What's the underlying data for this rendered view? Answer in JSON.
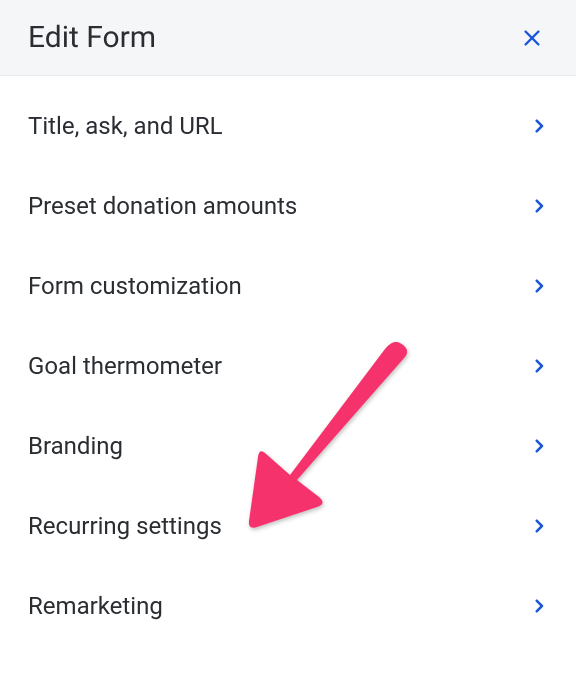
{
  "header": {
    "title": "Edit Form"
  },
  "menu": {
    "items": [
      {
        "label": "Title, ask, and URL"
      },
      {
        "label": "Preset donation amounts"
      },
      {
        "label": "Form customization"
      },
      {
        "label": "Goal thermometer"
      },
      {
        "label": "Branding"
      },
      {
        "label": "Recurring settings"
      },
      {
        "label": "Remarketing"
      }
    ]
  },
  "colors": {
    "accent": "#1a56db",
    "annotation": "#f6336c"
  }
}
